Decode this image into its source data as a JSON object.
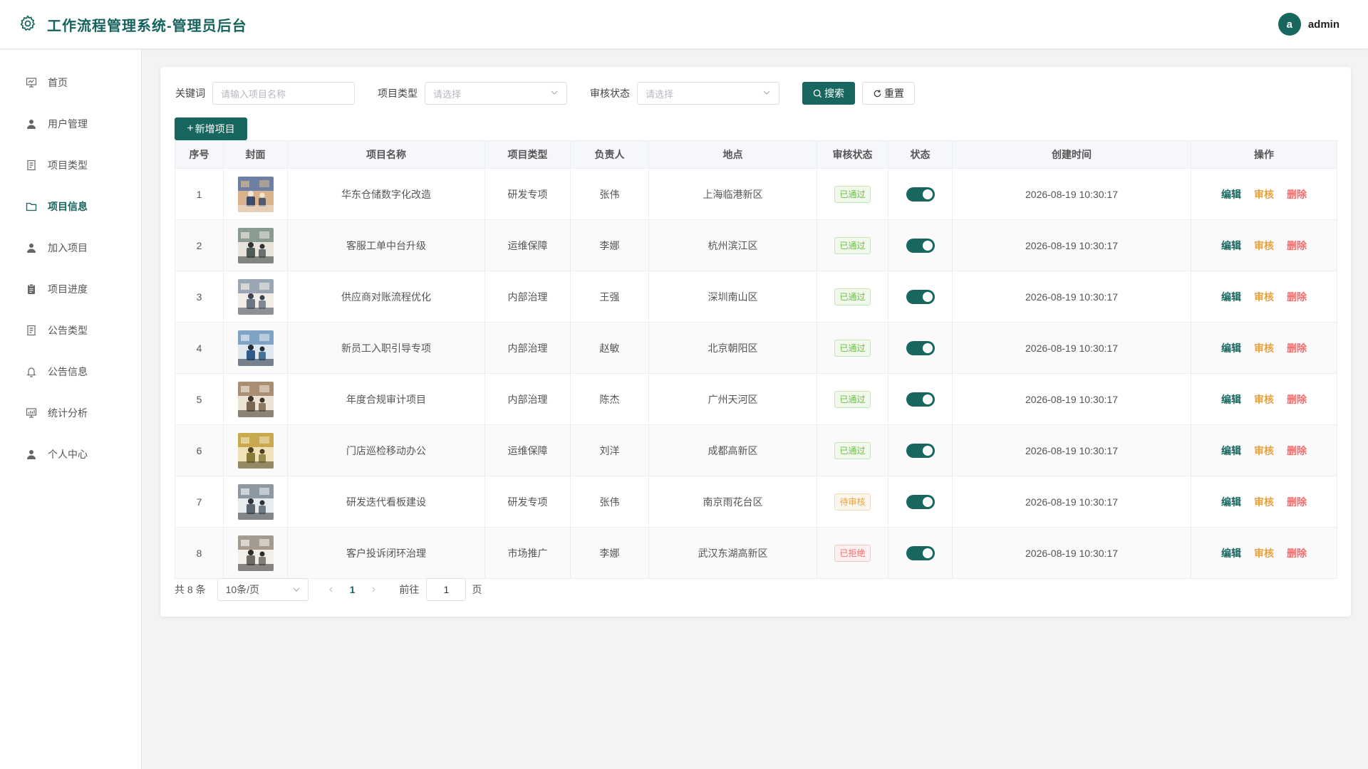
{
  "header": {
    "title": "工作流程管理系统-管理员后台",
    "avatar_letter": "a",
    "username": "admin",
    "accent": "#17675f"
  },
  "sidebar": {
    "active": "项目信息",
    "items": [
      {
        "label": "首页",
        "icon": "dashboard-icon"
      },
      {
        "label": "用户管理",
        "icon": "user-icon"
      },
      {
        "label": "项目类型",
        "icon": "document-icon"
      },
      {
        "label": "项目信息",
        "icon": "folder-icon"
      },
      {
        "label": "加入项目",
        "icon": "user-icon"
      },
      {
        "label": "项目进度",
        "icon": "clipboard-icon"
      },
      {
        "label": "公告类型",
        "icon": "document-icon"
      },
      {
        "label": "公告信息",
        "icon": "bell-icon"
      },
      {
        "label": "统计分析",
        "icon": "chart-icon"
      },
      {
        "label": "个人中心",
        "icon": "user-icon"
      }
    ]
  },
  "filters": {
    "keyword_label": "关键词",
    "keyword_placeholder": "请输入项目名称",
    "type_label": "项目类型",
    "type_placeholder": "请选择",
    "status_label": "审核状态",
    "status_placeholder": "请选择",
    "search_button": "搜索",
    "reset_button": "重置"
  },
  "add_button": "新增项目",
  "table": {
    "columns": [
      "序号",
      "封面",
      "项目名称",
      "项目类型",
      "负责人",
      "地点",
      "审核状态",
      "状态",
      "创建时间",
      "操作"
    ],
    "rows": [
      {
        "no": "1",
        "name": "华东仓储数字化改造",
        "type": "研发专项",
        "owner": "张伟",
        "location": "上海临港新区",
        "audit": "已通过",
        "enabled": true,
        "created": "2026-08-19 10:30:17"
      },
      {
        "no": "2",
        "name": "客服工单中台升级",
        "type": "运维保障",
        "owner": "李娜",
        "location": "杭州滨江区",
        "audit": "已通过",
        "enabled": true,
        "created": "2026-08-19 10:30:17"
      },
      {
        "no": "3",
        "name": "供应商对账流程优化",
        "type": "内部治理",
        "owner": "王强",
        "location": "深圳南山区",
        "audit": "已通过",
        "enabled": true,
        "created": "2026-08-19 10:30:17"
      },
      {
        "no": "4",
        "name": "新员工入职引导专项",
        "type": "内部治理",
        "owner": "赵敏",
        "location": "北京朝阳区",
        "audit": "已通过",
        "enabled": true,
        "created": "2026-08-19 10:30:17"
      },
      {
        "no": "5",
        "name": "年度合规审计项目",
        "type": "内部治理",
        "owner": "陈杰",
        "location": "广州天河区",
        "audit": "已通过",
        "enabled": true,
        "created": "2026-08-19 10:30:17"
      },
      {
        "no": "6",
        "name": "门店巡检移动办公",
        "type": "运维保障",
        "owner": "刘洋",
        "location": "成都高新区",
        "audit": "已通过",
        "enabled": true,
        "created": "2026-08-19 10:30:17"
      },
      {
        "no": "7",
        "name": "研发迭代看板建设",
        "type": "研发专项",
        "owner": "张伟",
        "location": "南京雨花台区",
        "audit": "待审核",
        "enabled": true,
        "created": "2026-08-19 10:30:17"
      },
      {
        "no": "8",
        "name": "客户投诉闭环治理",
        "type": "市场推广",
        "owner": "李娜",
        "location": "武汉东湖高新区",
        "audit": "已拒绝",
        "enabled": true,
        "created": "2026-08-19 10:30:17"
      }
    ],
    "ops": {
      "edit": "编辑",
      "audit": "审核",
      "delete": "删除"
    },
    "audit_colors": {
      "已通过": {
        "fg": "#67c23a",
        "bg": "#f0f9eb",
        "border": "#c2e7b0"
      },
      "待审核": {
        "fg": "#e6a23c",
        "bg": "#fdf6ec",
        "border": "#f5dab1"
      },
      "已拒绝": {
        "fg": "#f56c6c",
        "bg": "#fef0f0",
        "border": "#fbc4c4"
      }
    }
  },
  "pagination": {
    "total": "共 8 条",
    "page_size": "10条/页",
    "current": "1",
    "goto_label": "前往",
    "goto_value": "1",
    "page_unit": "页"
  }
}
